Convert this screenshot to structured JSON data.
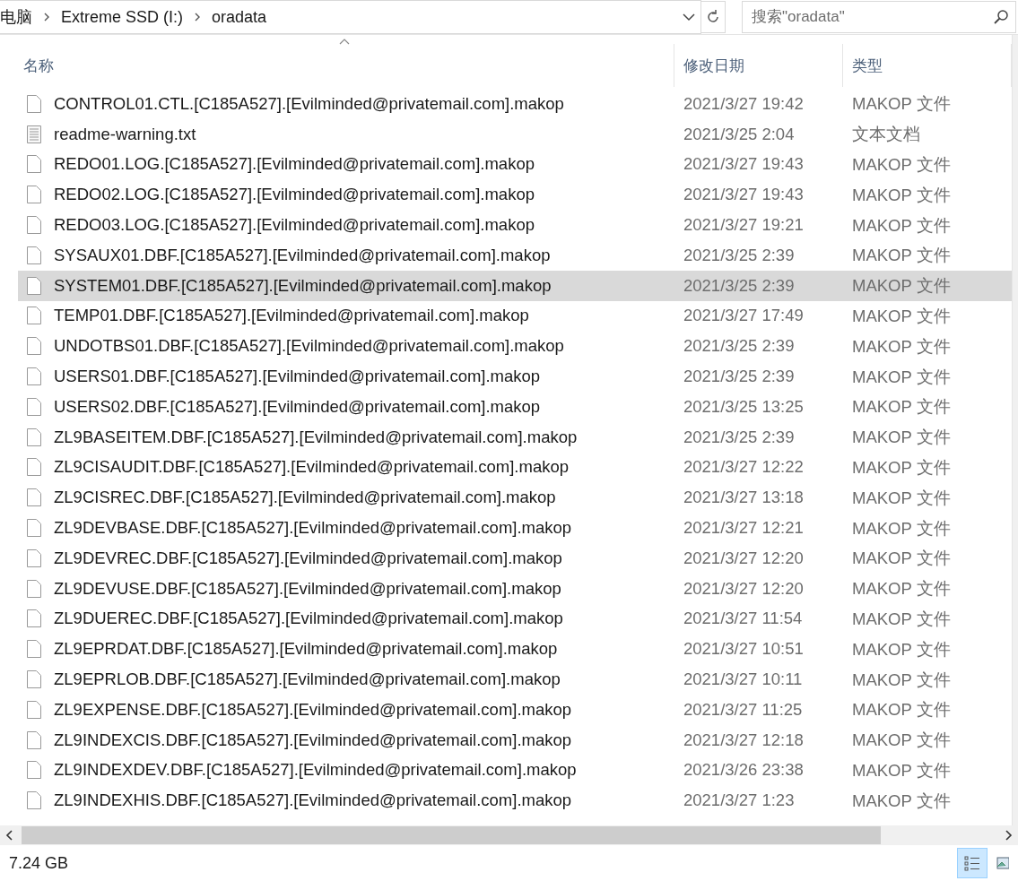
{
  "breadcrumb": [
    "电脑",
    "Extreme SSD (I:)",
    "oradata"
  ],
  "search": {
    "placeholder": "搜索\"oradata\""
  },
  "columns": [
    "名称",
    "修改日期",
    "类型"
  ],
  "rows": [
    {
      "kind": "file",
      "name": "CONTROL01.CTL.[C185A527].[Evilminded@privatemail.com].makop",
      "date": "2021/3/27 19:42",
      "type": "MAKOP 文件",
      "selected": false
    },
    {
      "kind": "text",
      "name": "readme-warning.txt",
      "date": "2021/3/25 2:04",
      "type": "文本文档",
      "selected": false
    },
    {
      "kind": "file",
      "name": "REDO01.LOG.[C185A527].[Evilminded@privatemail.com].makop",
      "date": "2021/3/27 19:43",
      "type": "MAKOP 文件",
      "selected": false
    },
    {
      "kind": "file",
      "name": "REDO02.LOG.[C185A527].[Evilminded@privatemail.com].makop",
      "date": "2021/3/27 19:43",
      "type": "MAKOP 文件",
      "selected": false
    },
    {
      "kind": "file",
      "name": "REDO03.LOG.[C185A527].[Evilminded@privatemail.com].makop",
      "date": "2021/3/27 19:21",
      "type": "MAKOP 文件",
      "selected": false
    },
    {
      "kind": "file",
      "name": "SYSAUX01.DBF.[C185A527].[Evilminded@privatemail.com].makop",
      "date": "2021/3/25 2:39",
      "type": "MAKOP 文件",
      "selected": false
    },
    {
      "kind": "file",
      "name": "SYSTEM01.DBF.[C185A527].[Evilminded@privatemail.com].makop",
      "date": "2021/3/25 2:39",
      "type": "MAKOP 文件",
      "selected": true
    },
    {
      "kind": "file",
      "name": "TEMP01.DBF.[C185A527].[Evilminded@privatemail.com].makop",
      "date": "2021/3/27 17:49",
      "type": "MAKOP 文件",
      "selected": false
    },
    {
      "kind": "file",
      "name": "UNDOTBS01.DBF.[C185A527].[Evilminded@privatemail.com].makop",
      "date": "2021/3/25 2:39",
      "type": "MAKOP 文件",
      "selected": false
    },
    {
      "kind": "file",
      "name": "USERS01.DBF.[C185A527].[Evilminded@privatemail.com].makop",
      "date": "2021/3/25 2:39",
      "type": "MAKOP 文件",
      "selected": false
    },
    {
      "kind": "file",
      "name": "USERS02.DBF.[C185A527].[Evilminded@privatemail.com].makop",
      "date": "2021/3/25 13:25",
      "type": "MAKOP 文件",
      "selected": false
    },
    {
      "kind": "file",
      "name": "ZL9BASEITEM.DBF.[C185A527].[Evilminded@privatemail.com].makop",
      "date": "2021/3/25 2:39",
      "type": "MAKOP 文件",
      "selected": false
    },
    {
      "kind": "file",
      "name": "ZL9CISAUDIT.DBF.[C185A527].[Evilminded@privatemail.com].makop",
      "date": "2021/3/27 12:22",
      "type": "MAKOP 文件",
      "selected": false
    },
    {
      "kind": "file",
      "name": "ZL9CISREC.DBF.[C185A527].[Evilminded@privatemail.com].makop",
      "date": "2021/3/27 13:18",
      "type": "MAKOP 文件",
      "selected": false
    },
    {
      "kind": "file",
      "name": "ZL9DEVBASE.DBF.[C185A527].[Evilminded@privatemail.com].makop",
      "date": "2021/3/27 12:21",
      "type": "MAKOP 文件",
      "selected": false
    },
    {
      "kind": "file",
      "name": "ZL9DEVREC.DBF.[C185A527].[Evilminded@privatemail.com].makop",
      "date": "2021/3/27 12:20",
      "type": "MAKOP 文件",
      "selected": false
    },
    {
      "kind": "file",
      "name": "ZL9DEVUSE.DBF.[C185A527].[Evilminded@privatemail.com].makop",
      "date": "2021/3/27 12:20",
      "type": "MAKOP 文件",
      "selected": false
    },
    {
      "kind": "file",
      "name": "ZL9DUEREC.DBF.[C185A527].[Evilminded@privatemail.com].makop",
      "date": "2021/3/27 11:54",
      "type": "MAKOP 文件",
      "selected": false
    },
    {
      "kind": "file",
      "name": "ZL9EPRDAT.DBF.[C185A527].[Evilminded@privatemail.com].makop",
      "date": "2021/3/27 10:51",
      "type": "MAKOP 文件",
      "selected": false
    },
    {
      "kind": "file",
      "name": "ZL9EPRLOB.DBF.[C185A527].[Evilminded@privatemail.com].makop",
      "date": "2021/3/27 10:11",
      "type": "MAKOP 文件",
      "selected": false
    },
    {
      "kind": "file",
      "name": "ZL9EXPENSE.DBF.[C185A527].[Evilminded@privatemail.com].makop",
      "date": "2021/3/27 11:25",
      "type": "MAKOP 文件",
      "selected": false
    },
    {
      "kind": "file",
      "name": "ZL9INDEXCIS.DBF.[C185A527].[Evilminded@privatemail.com].makop",
      "date": "2021/3/27 12:18",
      "type": "MAKOP 文件",
      "selected": false
    },
    {
      "kind": "file",
      "name": "ZL9INDEXDEV.DBF.[C185A527].[Evilminded@privatemail.com].makop",
      "date": "2021/3/26 23:38",
      "type": "MAKOP 文件",
      "selected": false
    },
    {
      "kind": "file",
      "name": "ZL9INDEXHIS.DBF.[C185A527].[Evilminded@privatemail.com].makop",
      "date": "2021/3/27 1:23",
      "type": "MAKOP 文件",
      "selected": false
    }
  ],
  "status_bar": {
    "size": "7.24 GB"
  }
}
